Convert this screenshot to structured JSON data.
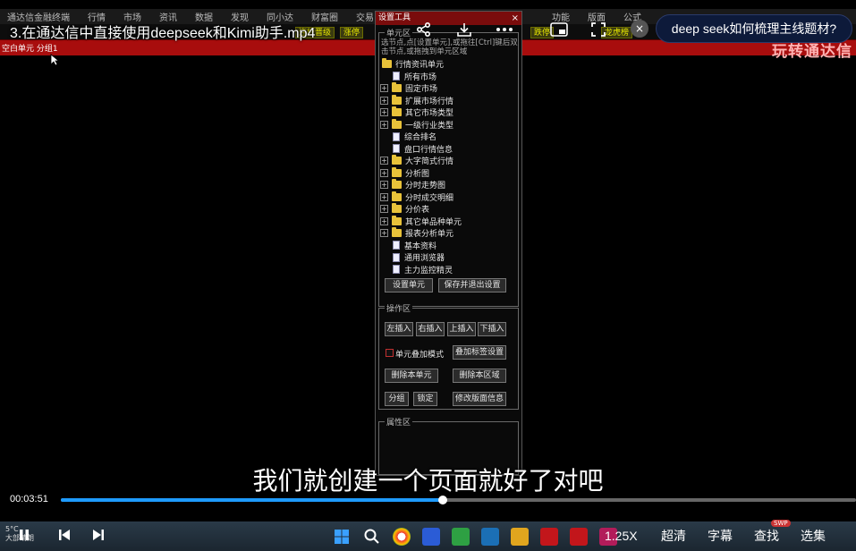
{
  "video": {
    "title": "3.在通达信中直接使用deepseek和Kimi助手.mp4",
    "subtitle": "我们就创建一个页面就好了对吧",
    "current_time": "00:03:51",
    "progress_fraction": 0.48,
    "question": "deep seek如何梳理主线题材?",
    "close_symbol": "×"
  },
  "app": {
    "menu": [
      "通达信金融终端",
      "行情",
      "市场",
      "资讯",
      "数据",
      "发现",
      "同小达",
      "财富圈",
      "交易"
    ],
    "menu_right": [
      "功能",
      "版面",
      "公式"
    ],
    "toolbar_chips": [
      "连板晋级",
      "涨停",
      "跌停",
      "龙虎榜"
    ],
    "red_strip_label": "空白单元 分组1",
    "red_strip_big": "玩转通达信"
  },
  "dialog": {
    "title": "设置工具",
    "close_symbol": "×",
    "unit_group": "单元区",
    "hint": "选节点,点[设置单元],或拖往[Ctrl]键后双击节点,或拖拽到单元区域",
    "tree": [
      {
        "label": "行情资讯单元",
        "type": "folder",
        "expand": "",
        "indent": 0
      },
      {
        "label": "所有市场",
        "type": "doc",
        "expand": "",
        "indent": 1
      },
      {
        "label": "固定市场",
        "type": "folder",
        "expand": "+",
        "indent": 1
      },
      {
        "label": "扩展市场行情",
        "type": "folder",
        "expand": "+",
        "indent": 1
      },
      {
        "label": "其它市场类型",
        "type": "folder",
        "expand": "+",
        "indent": 1
      },
      {
        "label": "一级行业类型",
        "type": "folder",
        "expand": "+",
        "indent": 1
      },
      {
        "label": "综合排名",
        "type": "doc",
        "expand": "",
        "indent": 1
      },
      {
        "label": "盘口行情信息",
        "type": "doc",
        "expand": "",
        "indent": 1
      },
      {
        "label": "大字简式行情",
        "type": "folder",
        "expand": "+",
        "indent": 1
      },
      {
        "label": "分析图",
        "type": "folder",
        "expand": "+",
        "indent": 1
      },
      {
        "label": "分时走势图",
        "type": "folder",
        "expand": "+",
        "indent": 1
      },
      {
        "label": "分时成交明细",
        "type": "folder",
        "expand": "+",
        "indent": 1
      },
      {
        "label": "分价表",
        "type": "folder",
        "expand": "+",
        "indent": 1
      },
      {
        "label": "其它单品种单元",
        "type": "folder",
        "expand": "+",
        "indent": 1
      },
      {
        "label": "报表分析单元",
        "type": "folder",
        "expand": "+",
        "indent": 1
      },
      {
        "label": "基本资料",
        "type": "doc",
        "expand": "",
        "indent": 1
      },
      {
        "label": "通用浏览器",
        "type": "doc",
        "expand": "",
        "indent": 1
      },
      {
        "label": "主力监控精灵",
        "type": "doc",
        "expand": "",
        "indent": 1
      }
    ],
    "set_unit_button": "设置单元",
    "save_exit_button": "保存并退出设置",
    "ops_group": "操作区",
    "insert_left": "左插入",
    "insert_right": "右插入",
    "insert_up": "上插入",
    "insert_down": "下插入",
    "overlay_mode_label": "单元叠加模式",
    "overlay_tab_settings": "叠加标签设置",
    "delete_unit": "删除本单元",
    "delete_area": "删除本区域",
    "group_button": "分组",
    "lock_button": "锁定",
    "edit_layout_info": "修改版面信息",
    "props_group": "属性区"
  },
  "controls": {
    "speed": "1.25X",
    "quality": "超清",
    "captions": "字幕",
    "search": "查找",
    "episodes": "选集",
    "swp": "SWP",
    "weather_temp": "5°C",
    "weather_text": "大部晴朗"
  },
  "icons": {
    "share": "share-icon",
    "download": "download-icon",
    "more": "more-icon",
    "pip": "picture-in-picture-icon",
    "fullscreen": "fullscreen-icon"
  }
}
